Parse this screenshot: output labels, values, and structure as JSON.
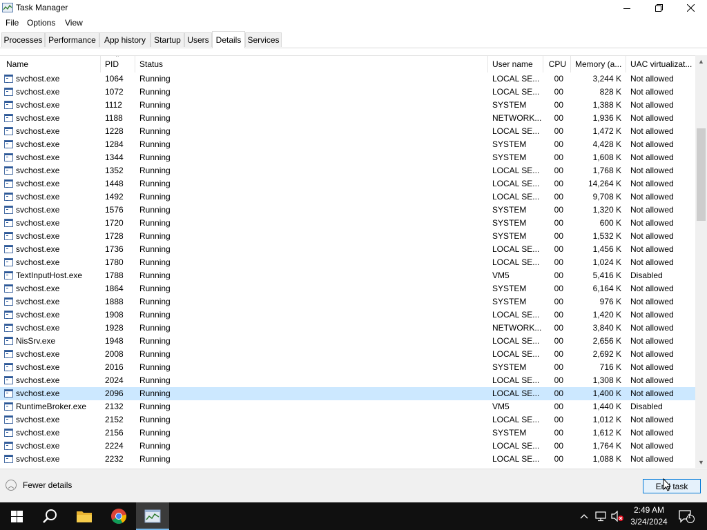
{
  "window": {
    "title": "Task Manager"
  },
  "menu": [
    "File",
    "Options",
    "View"
  ],
  "tabs": [
    "Processes",
    "Performance",
    "App history",
    "Startup",
    "Users",
    "Details",
    "Services"
  ],
  "active_tab": "Details",
  "columns": {
    "name": "Name",
    "pid": "PID",
    "status": "Status",
    "user": "User name",
    "cpu": "CPU",
    "memory": "Memory (a...",
    "uac": "UAC virtualizat..."
  },
  "processes": [
    {
      "name": "svchost.exe",
      "pid": "1064",
      "status": "Running",
      "user": "LOCAL SE...",
      "cpu": "00",
      "memory": "3,244 K",
      "uac": "Not allowed"
    },
    {
      "name": "svchost.exe",
      "pid": "1072",
      "status": "Running",
      "user": "LOCAL SE...",
      "cpu": "00",
      "memory": "828 K",
      "uac": "Not allowed"
    },
    {
      "name": "svchost.exe",
      "pid": "1112",
      "status": "Running",
      "user": "SYSTEM",
      "cpu": "00",
      "memory": "1,388 K",
      "uac": "Not allowed"
    },
    {
      "name": "svchost.exe",
      "pid": "1188",
      "status": "Running",
      "user": "NETWORK...",
      "cpu": "00",
      "memory": "1,936 K",
      "uac": "Not allowed"
    },
    {
      "name": "svchost.exe",
      "pid": "1228",
      "status": "Running",
      "user": "LOCAL SE...",
      "cpu": "00",
      "memory": "1,472 K",
      "uac": "Not allowed"
    },
    {
      "name": "svchost.exe",
      "pid": "1284",
      "status": "Running",
      "user": "SYSTEM",
      "cpu": "00",
      "memory": "4,428 K",
      "uac": "Not allowed"
    },
    {
      "name": "svchost.exe",
      "pid": "1344",
      "status": "Running",
      "user": "SYSTEM",
      "cpu": "00",
      "memory": "1,608 K",
      "uac": "Not allowed"
    },
    {
      "name": "svchost.exe",
      "pid": "1352",
      "status": "Running",
      "user": "LOCAL SE...",
      "cpu": "00",
      "memory": "1,768 K",
      "uac": "Not allowed"
    },
    {
      "name": "svchost.exe",
      "pid": "1448",
      "status": "Running",
      "user": "LOCAL SE...",
      "cpu": "00",
      "memory": "14,264 K",
      "uac": "Not allowed"
    },
    {
      "name": "svchost.exe",
      "pid": "1492",
      "status": "Running",
      "user": "LOCAL SE...",
      "cpu": "00",
      "memory": "9,708 K",
      "uac": "Not allowed"
    },
    {
      "name": "svchost.exe",
      "pid": "1576",
      "status": "Running",
      "user": "SYSTEM",
      "cpu": "00",
      "memory": "1,320 K",
      "uac": "Not allowed"
    },
    {
      "name": "svchost.exe",
      "pid": "1720",
      "status": "Running",
      "user": "SYSTEM",
      "cpu": "00",
      "memory": "600 K",
      "uac": "Not allowed"
    },
    {
      "name": "svchost.exe",
      "pid": "1728",
      "status": "Running",
      "user": "SYSTEM",
      "cpu": "00",
      "memory": "1,532 K",
      "uac": "Not allowed"
    },
    {
      "name": "svchost.exe",
      "pid": "1736",
      "status": "Running",
      "user": "LOCAL SE...",
      "cpu": "00",
      "memory": "1,456 K",
      "uac": "Not allowed"
    },
    {
      "name": "svchost.exe",
      "pid": "1780",
      "status": "Running",
      "user": "LOCAL SE...",
      "cpu": "00",
      "memory": "1,024 K",
      "uac": "Not allowed"
    },
    {
      "name": "TextInputHost.exe",
      "pid": "1788",
      "status": "Running",
      "user": "VM5",
      "cpu": "00",
      "memory": "5,416 K",
      "uac": "Disabled"
    },
    {
      "name": "svchost.exe",
      "pid": "1864",
      "status": "Running",
      "user": "SYSTEM",
      "cpu": "00",
      "memory": "6,164 K",
      "uac": "Not allowed"
    },
    {
      "name": "svchost.exe",
      "pid": "1888",
      "status": "Running",
      "user": "SYSTEM",
      "cpu": "00",
      "memory": "976 K",
      "uac": "Not allowed"
    },
    {
      "name": "svchost.exe",
      "pid": "1908",
      "status": "Running",
      "user": "LOCAL SE...",
      "cpu": "00",
      "memory": "1,420 K",
      "uac": "Not allowed"
    },
    {
      "name": "svchost.exe",
      "pid": "1928",
      "status": "Running",
      "user": "NETWORK...",
      "cpu": "00",
      "memory": "3,840 K",
      "uac": "Not allowed"
    },
    {
      "name": "NisSrv.exe",
      "pid": "1948",
      "status": "Running",
      "user": "LOCAL SE...",
      "cpu": "00",
      "memory": "2,656 K",
      "uac": "Not allowed"
    },
    {
      "name": "svchost.exe",
      "pid": "2008",
      "status": "Running",
      "user": "LOCAL SE...",
      "cpu": "00",
      "memory": "2,692 K",
      "uac": "Not allowed"
    },
    {
      "name": "svchost.exe",
      "pid": "2016",
      "status": "Running",
      "user": "SYSTEM",
      "cpu": "00",
      "memory": "716 K",
      "uac": "Not allowed"
    },
    {
      "name": "svchost.exe",
      "pid": "2024",
      "status": "Running",
      "user": "LOCAL SE...",
      "cpu": "00",
      "memory": "1,308 K",
      "uac": "Not allowed"
    },
    {
      "name": "svchost.exe",
      "pid": "2096",
      "status": "Running",
      "user": "LOCAL SE...",
      "cpu": "00",
      "memory": "1,400 K",
      "uac": "Not allowed",
      "selected": true
    },
    {
      "name": "RuntimeBroker.exe",
      "pid": "2132",
      "status": "Running",
      "user": "VM5",
      "cpu": "00",
      "memory": "1,440 K",
      "uac": "Disabled"
    },
    {
      "name": "svchost.exe",
      "pid": "2152",
      "status": "Running",
      "user": "LOCAL SE...",
      "cpu": "00",
      "memory": "1,012 K",
      "uac": "Not allowed"
    },
    {
      "name": "svchost.exe",
      "pid": "2156",
      "status": "Running",
      "user": "SYSTEM",
      "cpu": "00",
      "memory": "1,612 K",
      "uac": "Not allowed"
    },
    {
      "name": "svchost.exe",
      "pid": "2224",
      "status": "Running",
      "user": "LOCAL SE...",
      "cpu": "00",
      "memory": "1,764 K",
      "uac": "Not allowed"
    },
    {
      "name": "svchost.exe",
      "pid": "2232",
      "status": "Running",
      "user": "LOCAL SE...",
      "cpu": "00",
      "memory": "1,088 K",
      "uac": "Not allowed"
    }
  ],
  "footer": {
    "fewer_details": "Fewer details",
    "end_task": "End task"
  },
  "taskbar": {
    "time": "2:49 AM",
    "date": "3/24/2024",
    "notification_count": "1"
  },
  "colors": {
    "selection": "#cce8ff",
    "taskbar": "#101010",
    "accent": "#0078d7"
  },
  "icons": [
    "app-icon",
    "minimize-icon",
    "maximize-icon",
    "close-icon",
    "windows-start-icon",
    "search-icon",
    "file-explorer-icon",
    "chrome-icon",
    "task-manager-icon",
    "chevron-up-icon",
    "network-icon",
    "volume-muted-icon",
    "notification-icon"
  ]
}
